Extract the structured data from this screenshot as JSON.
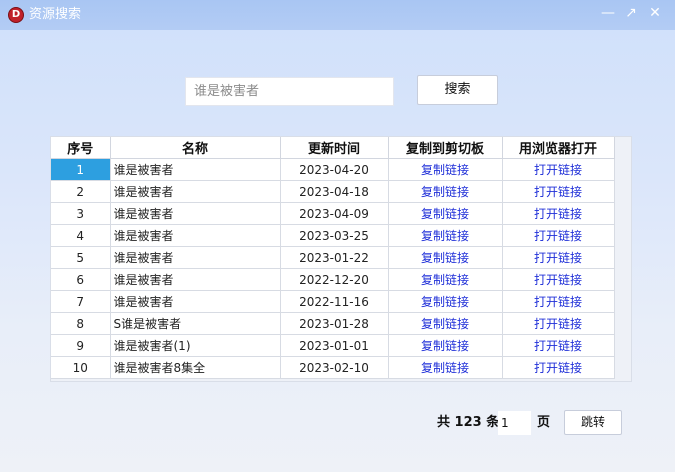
{
  "window": {
    "title": "资源搜索",
    "app_icon_letter": "D",
    "controls": {
      "minimize": "—",
      "maximize": "↗",
      "close": "✕"
    }
  },
  "search": {
    "placeholder": "谁是被害者",
    "value": "",
    "button_label": "搜索"
  },
  "table": {
    "columns": [
      "序号",
      "名称",
      "更新时间",
      "复制到剪切板",
      "用浏览器打开"
    ],
    "selected_row": 0,
    "rows": [
      {
        "index": "1",
        "name": "谁是被害者",
        "date": "2023-04-20",
        "copy": "复制链接",
        "open": "打开链接"
      },
      {
        "index": "2",
        "name": "谁是被害者",
        "date": "2023-04-18",
        "copy": "复制链接",
        "open": "打开链接"
      },
      {
        "index": "3",
        "name": "谁是被害者",
        "date": "2023-04-09",
        "copy": "复制链接",
        "open": "打开链接"
      },
      {
        "index": "4",
        "name": "谁是被害者",
        "date": "2023-03-25",
        "copy": "复制链接",
        "open": "打开链接"
      },
      {
        "index": "5",
        "name": "谁是被害者",
        "date": "2023-01-22",
        "copy": "复制链接",
        "open": "打开链接"
      },
      {
        "index": "6",
        "name": "谁是被害者",
        "date": "2022-12-20",
        "copy": "复制链接",
        "open": "打开链接"
      },
      {
        "index": "7",
        "name": "谁是被害者",
        "date": "2022-11-16",
        "copy": "复制链接",
        "open": "打开链接"
      },
      {
        "index": "8",
        "name": "S谁是被害者",
        "date": "2023-01-28",
        "copy": "复制链接",
        "open": "打开链接"
      },
      {
        "index": "9",
        "name": "谁是被害者(1)",
        "date": "2023-01-01",
        "copy": "复制链接",
        "open": "打开链接"
      },
      {
        "index": "10",
        "name": "谁是被害者8集全",
        "date": "2023-02-10",
        "copy": "复制链接",
        "open": "打开链接"
      }
    ]
  },
  "pager": {
    "total_text": "共 123 条",
    "page_value": "1",
    "page_suffix": "页",
    "jump_label": "跳转"
  },
  "colors": {
    "link": "#1f2fd8",
    "selected_cell": "#2d9fe0",
    "title_bar": "#a9c6f3"
  }
}
